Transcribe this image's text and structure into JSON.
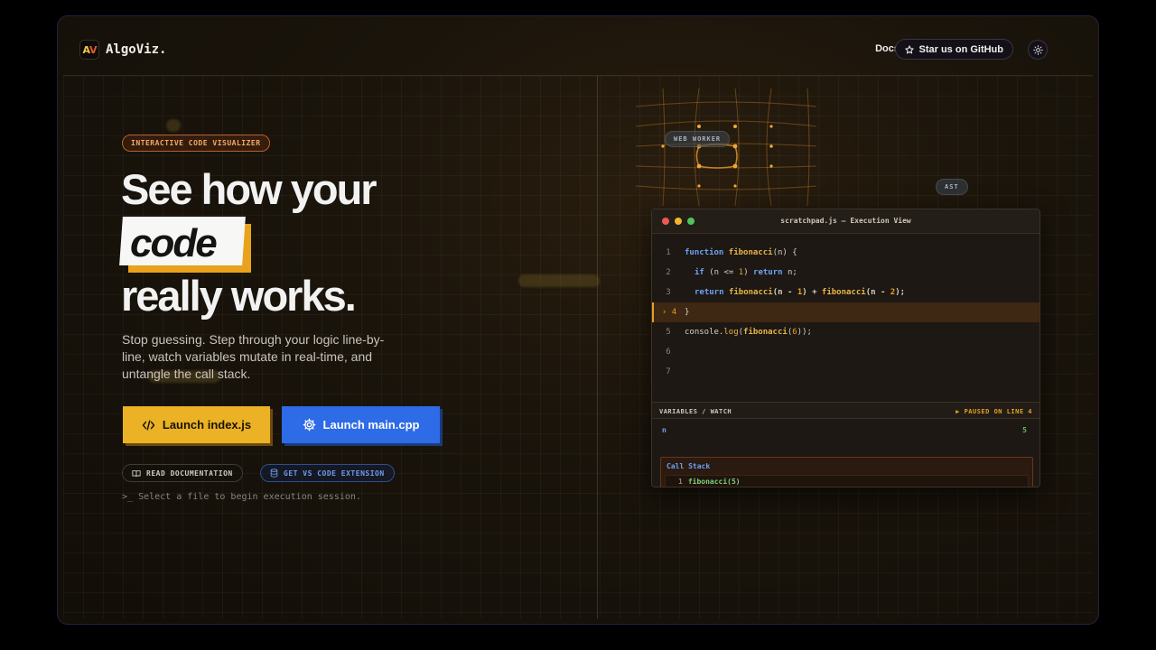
{
  "header": {
    "logo_text": "AV",
    "brand": "AlgoViz.",
    "docs_link": "Docs",
    "github_button": "Star us on GitHub"
  },
  "hero": {
    "badge": "INTERACTIVE CODE VISUALIZER",
    "title_line1": "See how your",
    "title_highlight": "code",
    "title_line3": "really works.",
    "subtitle": "Stop guessing. Step through your logic line-by-line, watch variables mutate in real-time, and untangle the call stack.",
    "btn_js": "Launch index.js",
    "btn_cpp": "Launch main.cpp",
    "read_docs": "READ DOCUMENTATION",
    "vscode_ext": "GET VS CODE EXTENSION",
    "status": "Select a file to begin execution session.",
    "status_prompt": ">_"
  },
  "tags": {
    "web_worker": "WEB WORKER",
    "ast": "AST"
  },
  "editor": {
    "filename": "scratchpad.js — Execution View",
    "line_numbers": [
      "1",
      "2",
      "3",
      "4",
      "5",
      "6",
      "7"
    ],
    "active_line": 4,
    "vars_label": "VARIABLES / WATCH",
    "paused_label": "PAUSED ON LINE 4",
    "variable_name": "n",
    "variable_value": "5",
    "callstack_label": "Call Stack",
    "callstack_index": "1",
    "callstack_frame": "fibonacci(5)"
  },
  "colors": {
    "accent_orange": "#e6a022",
    "js_button": "#eab224",
    "cpp_button": "#2e6be6",
    "keyword_blue": "#6ea2f5"
  }
}
